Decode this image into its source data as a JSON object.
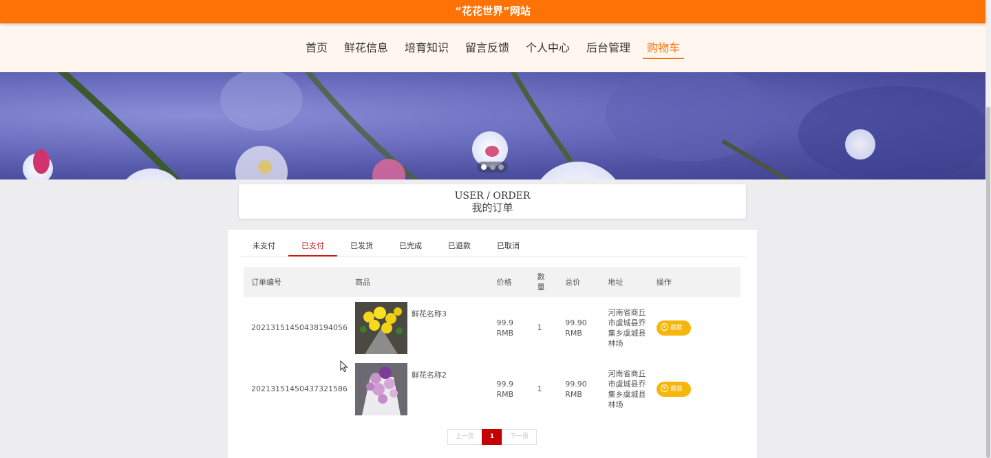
{
  "site": {
    "title": "“花花世界”网站"
  },
  "nav": {
    "items": [
      {
        "label": "首页"
      },
      {
        "label": "鲜花信息"
      },
      {
        "label": "培育知识"
      },
      {
        "label": "留言反馈"
      },
      {
        "label": "个人中心"
      },
      {
        "label": "后台管理"
      },
      {
        "label": "购物车"
      }
    ],
    "active": "购物车"
  },
  "banner": {
    "slide_count": 3,
    "active_slide": 1
  },
  "order_header": {
    "en": "USER / ORDER",
    "cn": "我的订单"
  },
  "tabs": [
    {
      "label": "未支付"
    },
    {
      "label": "已支付"
    },
    {
      "label": "已发货"
    },
    {
      "label": "已完成"
    },
    {
      "label": "已退款"
    },
    {
      "label": "已取消"
    }
  ],
  "active_tab": "已支付",
  "table": {
    "headers": {
      "order_no": "订单编号",
      "goods": "商品",
      "price": "价格",
      "qty": "数量",
      "total": "总价",
      "address": "地址",
      "action": "操作"
    },
    "rows": [
      {
        "order_no": "20213151450438194056",
        "goods_name": "鲜花名称3",
        "price": "99.9 RMB",
        "qty": "1",
        "total": "99.90 RMB",
        "address": "河南省商丘市虞城县乔集乡虞城县林场",
        "action_label": "退款",
        "image_icon": "yellow-flower-bouquet-image"
      },
      {
        "order_no": "20213151450437321586",
        "goods_name": "鲜花名称2",
        "price": "99.9 RMB",
        "qty": "1",
        "total": "99.90 RMB",
        "address": "河南省商丘市虞城县乔集乡虞城县林场",
        "action_label": "退款",
        "image_icon": "purple-flower-bouquet-image"
      }
    ]
  },
  "pagination": {
    "prev": "上一页",
    "current": "1",
    "next": "下一页"
  },
  "colors": {
    "brand": "#fe7206",
    "active_tab": "#c91818",
    "refund": "#f6b60c",
    "page_active": "#c40000"
  }
}
